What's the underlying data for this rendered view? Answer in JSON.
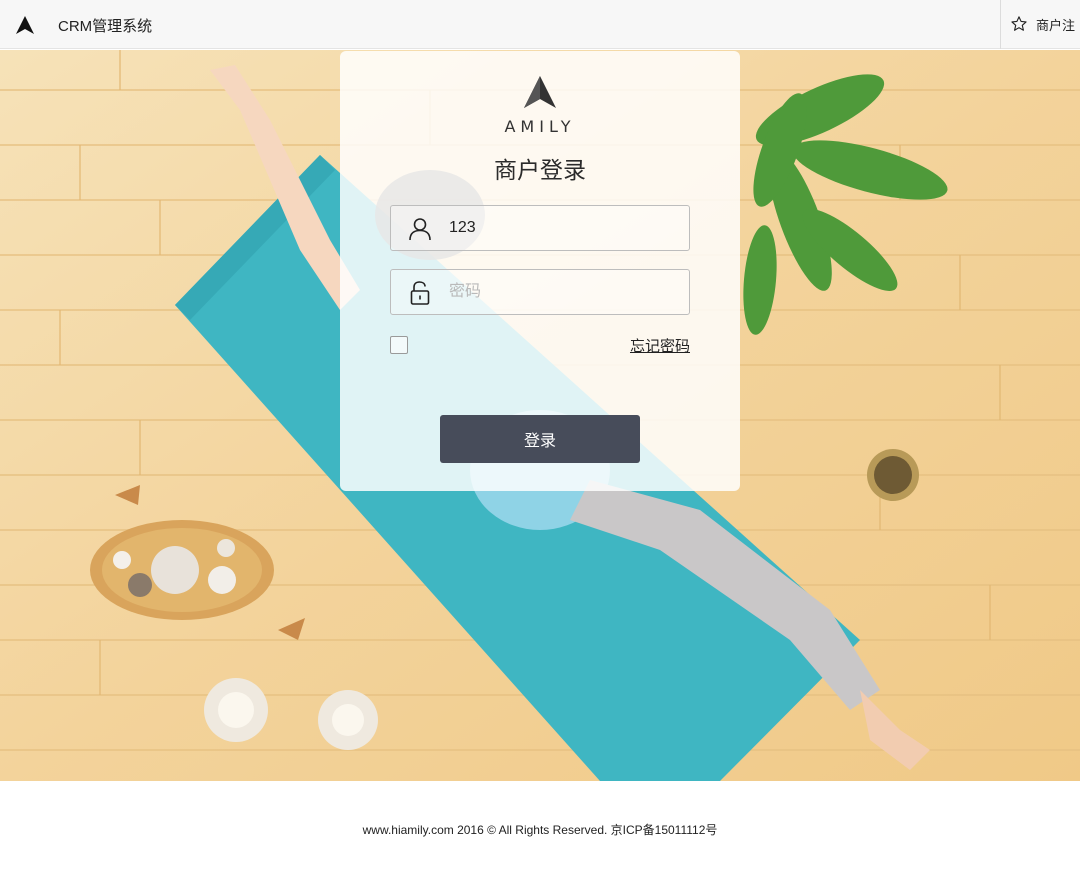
{
  "header": {
    "app_title": "CRM管理系统",
    "register_label": "商户注"
  },
  "login": {
    "brand_name": "AMILY",
    "title": "商户登录",
    "username_value": "123",
    "password_placeholder": "密码",
    "remember_checked": false,
    "forgot_label": "忘记密码",
    "submit_label": "登录"
  },
  "footer": {
    "copyright": "www.hiamily.com 2016 © All Rights Reserved. 京ICP备15011112号"
  },
  "colors": {
    "topbar_bg": "#f7f7f7",
    "button_bg": "#474c5a",
    "mat": "#3fb6c2",
    "floor": "#f4d9a6"
  },
  "icons": {
    "logo": "amily-logo-icon",
    "register": "star-icon",
    "username": "user-icon",
    "password": "unlock-icon"
  }
}
